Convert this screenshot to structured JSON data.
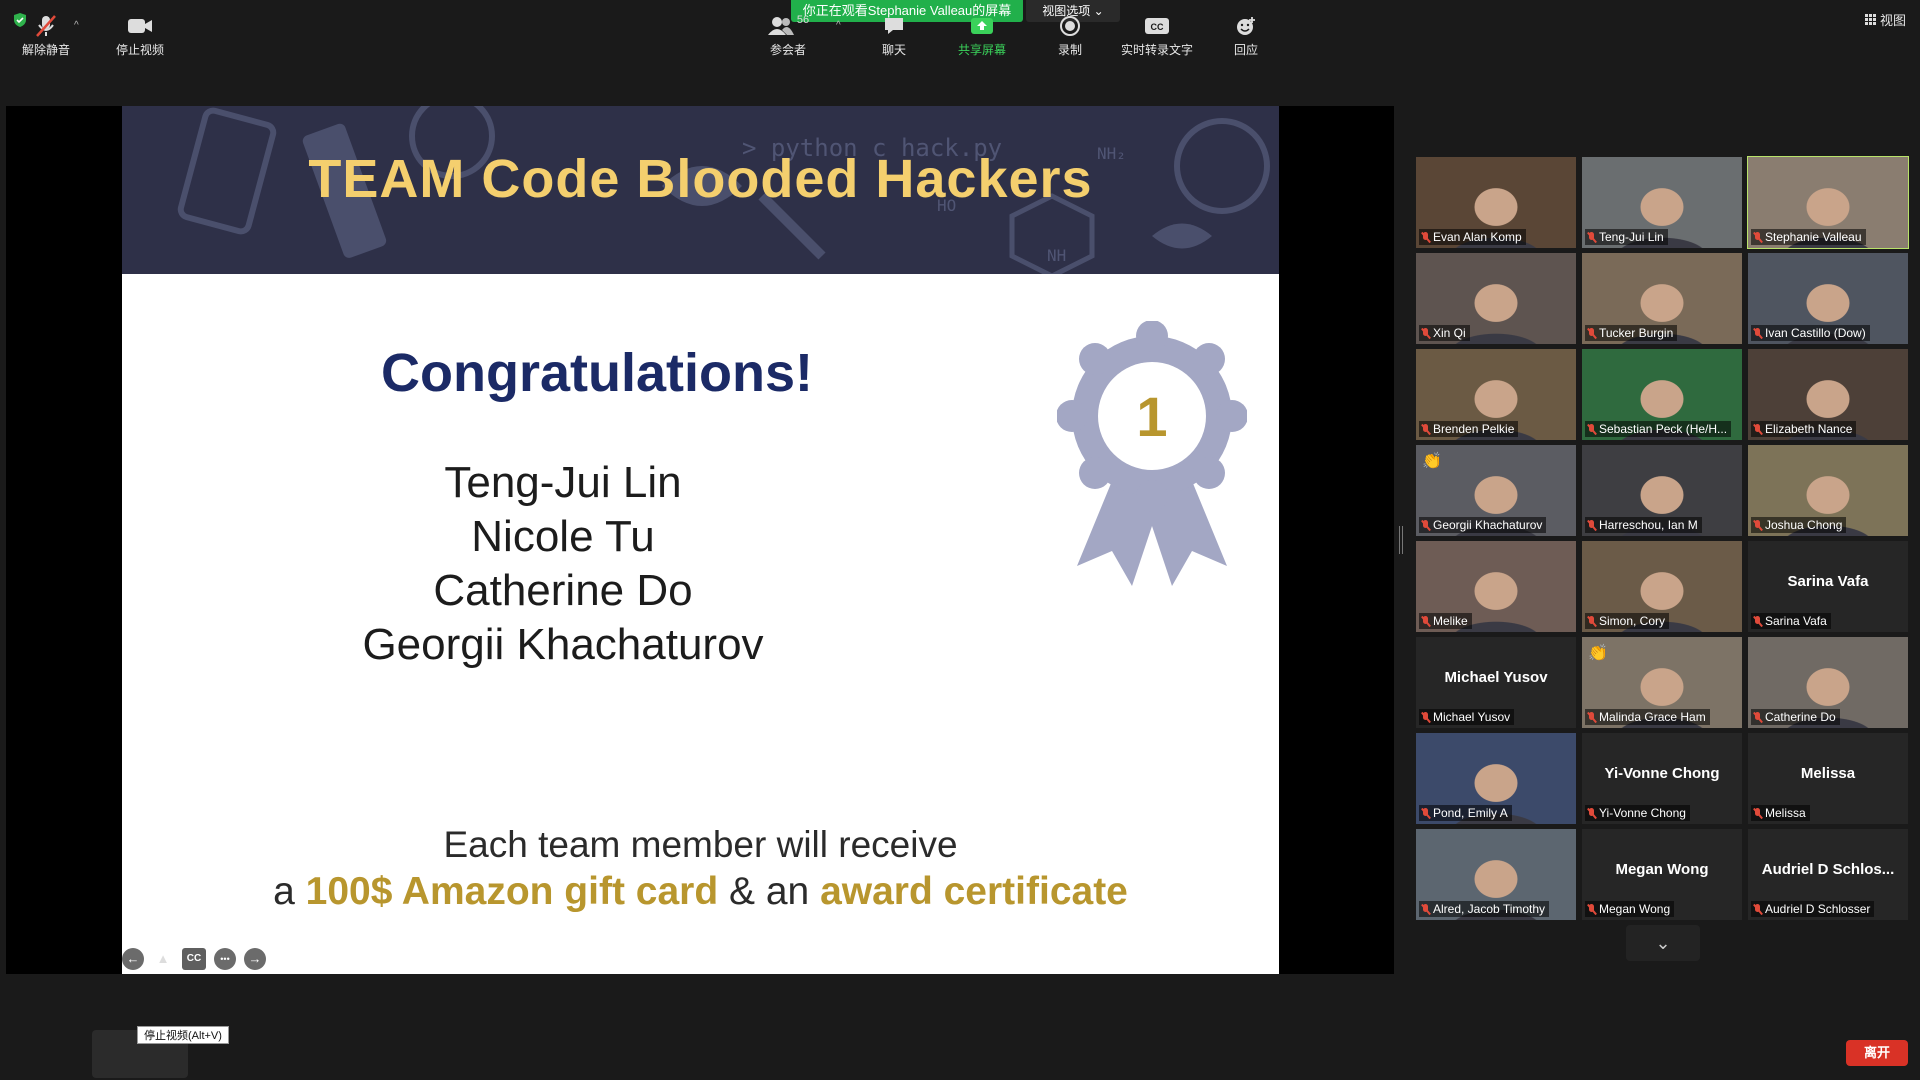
{
  "top_bar": {
    "viewing_banner": "你正在观看Stephanie  Valleau的屏幕",
    "view_options": "视图选项 ⌄",
    "view_button": "视图"
  },
  "slide": {
    "header_title": "TEAM Code Blooded Hackers",
    "header_deco_code": "> python c hack.py",
    "header_deco_nh2": "NH₂",
    "header_deco_nh": "NH",
    "header_deco_ho": "HO",
    "congrats": "Congratulations!",
    "names": [
      "Teng-Jui Lin",
      "Nicole Tu",
      "Catherine Do",
      "Georgii Khachaturov"
    ],
    "badge_number": "1",
    "prize_line1": "Each team member will receive",
    "prize_line2_a": "a ",
    "prize_line2_gift": "100$ Amazon gift card",
    "prize_line2_b": " & an ",
    "prize_line2_cert": "award certificate",
    "controls": {
      "cc": "CC",
      "more": "•••"
    }
  },
  "participants": [
    {
      "name": "Evan Alan Komp",
      "video": true
    },
    {
      "name": "Teng-Jui Lin",
      "video": true
    },
    {
      "name": "Stephanie Valleau",
      "video": true,
      "active_speaker": true
    },
    {
      "name": "Xin Qi",
      "video": true
    },
    {
      "name": "Tucker Burgin",
      "video": true
    },
    {
      "name": "Ivan Castillo (Dow)",
      "video": true
    },
    {
      "name": "Brenden Pelkie",
      "video": true
    },
    {
      "name": "Sebastian Peck (He/H...",
      "video": true
    },
    {
      "name": "Elizabeth Nance",
      "video": true
    },
    {
      "name": "Georgii Khachaturov",
      "video": true,
      "hand": true
    },
    {
      "name": "Harreschou, Ian M",
      "video": true
    },
    {
      "name": "Joshua Chong",
      "video": true
    },
    {
      "name": "Melike",
      "video": true
    },
    {
      "name": "Simon, Cory",
      "video": true
    },
    {
      "name": "Sarina Vafa",
      "video": false,
      "display": "Sarina Vafa"
    },
    {
      "name": "Michael Yusov",
      "video": false,
      "display": "Michael Yusov"
    },
    {
      "name": "Malinda Grace Ham",
      "video": true,
      "hand": true
    },
    {
      "name": "Catherine Do",
      "video": true
    },
    {
      "name": "Pond, Emily A",
      "video": true
    },
    {
      "name": "Yi-Vonne Chong",
      "video": false,
      "display": "Yi-Vonne Chong"
    },
    {
      "name": "Melissa",
      "video": false,
      "display": "Melissa"
    },
    {
      "name": "Alred, Jacob Timothy",
      "video": true
    },
    {
      "name": "Megan Wong",
      "video": false,
      "display": "Megan Wong"
    },
    {
      "name": "Audriel D Schlosser",
      "video": false,
      "display": "Audriel D Schlos..."
    }
  ],
  "toolbar": {
    "unmute": "解除静音",
    "stop_video": "停止视频",
    "stop_video_tooltip": "停止视频(Alt+V)",
    "participants": "参会者",
    "participant_count": "56",
    "chat": "聊天",
    "share_screen": "共享屏幕",
    "record": "录制",
    "live_transcript": "实时转录文字",
    "reactions": "回应",
    "leave": "离开"
  },
  "colors": {
    "accent_green": "#21b04b",
    "leave_red": "#d93226",
    "slide_header_bg": "#2e3048",
    "title_gold": "#f4cf6e",
    "congrats_navy": "#1b2a66",
    "prize_gold": "#b8962e",
    "active_speaker_outline": "#b9e36a"
  }
}
